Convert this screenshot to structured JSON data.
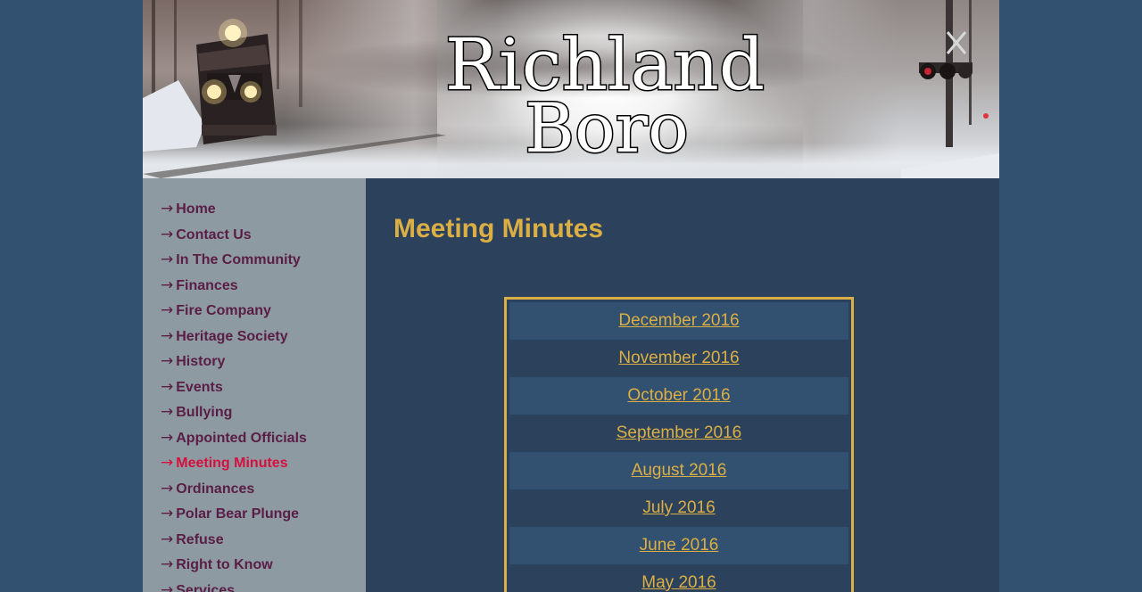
{
  "header": {
    "title_line1": "Richland",
    "title_line2": "Boro"
  },
  "sidebar": {
    "arrow": "→",
    "items": [
      {
        "label": "Home"
      },
      {
        "label": "Contact Us"
      },
      {
        "label": "In The Community"
      },
      {
        "label": "Finances"
      },
      {
        "label": "Fire Company"
      },
      {
        "label": "Heritage Society"
      },
      {
        "label": "History"
      },
      {
        "label": "Events"
      },
      {
        "label": "Bullying"
      },
      {
        "label": "Appointed Officials"
      },
      {
        "label": "Meeting Minutes"
      },
      {
        "label": "Ordinances"
      },
      {
        "label": "Polar Bear Plunge"
      },
      {
        "label": "Refuse"
      },
      {
        "label": "Right to Know"
      },
      {
        "label": "Services"
      }
    ],
    "active_item": "Meeting Minutes"
  },
  "main": {
    "title": "Meeting Minutes",
    "minutes": [
      {
        "label": "December 2016"
      },
      {
        "label": "November 2016"
      },
      {
        "label": "October 2016"
      },
      {
        "label": "September 2016"
      },
      {
        "label": "August 2016"
      },
      {
        "label": "July 2016"
      },
      {
        "label": "June 2016"
      },
      {
        "label": "May 2016"
      }
    ]
  },
  "colors": {
    "page_background": "#32506f",
    "sidebar_background": "#8d9aa2",
    "content_background": "#2c425c",
    "accent_gold": "#dbaf44",
    "nav_text": "#5a1d45",
    "nav_active": "#d6103e"
  }
}
